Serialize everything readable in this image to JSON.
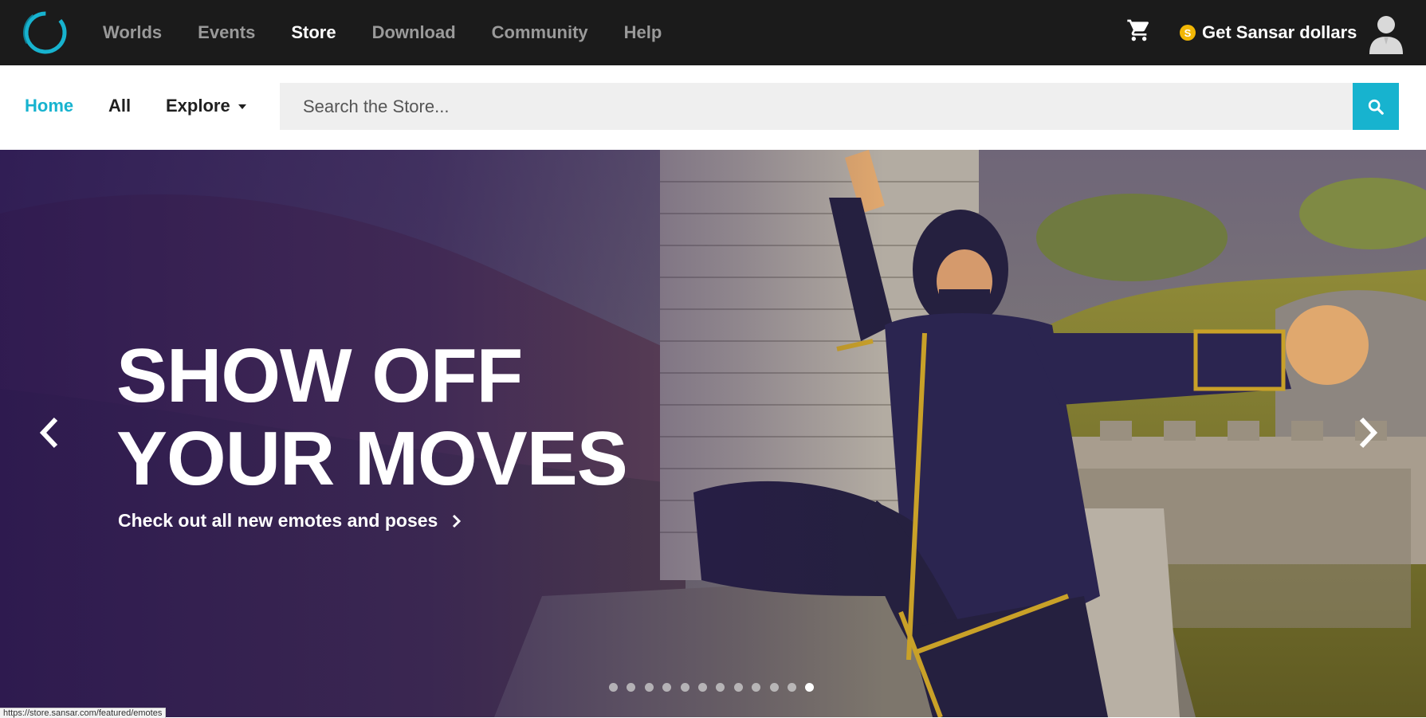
{
  "topnav": {
    "links": [
      {
        "label": "Worlds",
        "active": false
      },
      {
        "label": "Events",
        "active": false
      },
      {
        "label": "Store",
        "active": true
      },
      {
        "label": "Download",
        "active": false
      },
      {
        "label": "Community",
        "active": false
      },
      {
        "label": "Help",
        "active": false
      }
    ],
    "cart_icon": "shopping-cart-icon",
    "coin_symbol": "S",
    "dollars_label": "Get Sansar dollars",
    "avatar_icon": "user-avatar-icon",
    "logo_icon": "sansar-logo-icon"
  },
  "storebar": {
    "tabs": [
      {
        "label": "Home",
        "active": true
      },
      {
        "label": "All",
        "active": false
      },
      {
        "label": "Explore",
        "active": false,
        "has_dropdown": true
      }
    ],
    "search": {
      "placeholder": "Search the Store...",
      "value": ""
    },
    "search_icon": "search-icon"
  },
  "hero": {
    "headline_line1": "SHOW OFF",
    "headline_line2": "YOUR MOVES",
    "subline": "Check out all new emotes and poses",
    "prev_icon": "chevron-left-icon",
    "next_icon": "chevron-right-icon",
    "slide_count": 12,
    "active_slide": 12
  },
  "status_url": "https://store.sansar.com/featured/emotes",
  "colors": {
    "accent": "#17b3cf",
    "nav_bg": "#1b1b1b",
    "coin": "#f2b705",
    "search_bg": "#efefef"
  }
}
